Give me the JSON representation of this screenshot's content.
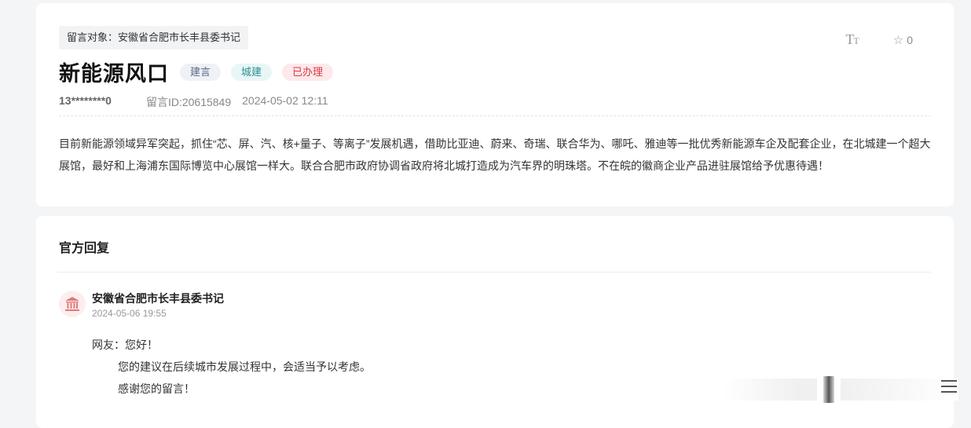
{
  "message": {
    "target": "留言对象：安徽省合肥市长丰县委书记",
    "title": "新能源风口",
    "badges": {
      "type": "建言",
      "category": "城建",
      "status": "已办理"
    },
    "user": "13********0",
    "id_text": "留言ID:20615849",
    "datetime": "2024-05-02 12:11",
    "content": "目前新能源领域异军突起，抓住“芯、屏、汽、核+量子、等离子”发展机遇，借助比亚迪、蔚来、奇瑞、联合华为、哪吒、雅迪等一批优秀新能源车企及配套企业，在北城建一个超大展馆，最好和上海浦东国际博览中心展馆一样大。联合合肥市政府协调省政府将北城打造成为汽车界的明珠塔。不在皖的徽商企业产品进驻展馆给予优惠待遇！"
  },
  "toolbar": {
    "font_size_icon": "text-size-icon",
    "favorite_count": "0",
    "favorite_icon": "star-outline-icon"
  },
  "reply": {
    "heading": "官方回复",
    "org_icon": "government-building-icon",
    "org_name": "安徽省合肥市长丰县委书记",
    "datetime": "2024-05-06 19:55",
    "greeting": "网友：您好！",
    "line1": "您的建议在后续城市发展过程中，会适当予以考虑。",
    "line2": "感谢您的留言！"
  },
  "colors": {
    "status_red": "#d93a45",
    "category_teal": "#2e8f8f",
    "type_slate": "#5d6a86",
    "avatar_bg": "#fdeeee",
    "avatar_icon": "#e07a7a"
  }
}
